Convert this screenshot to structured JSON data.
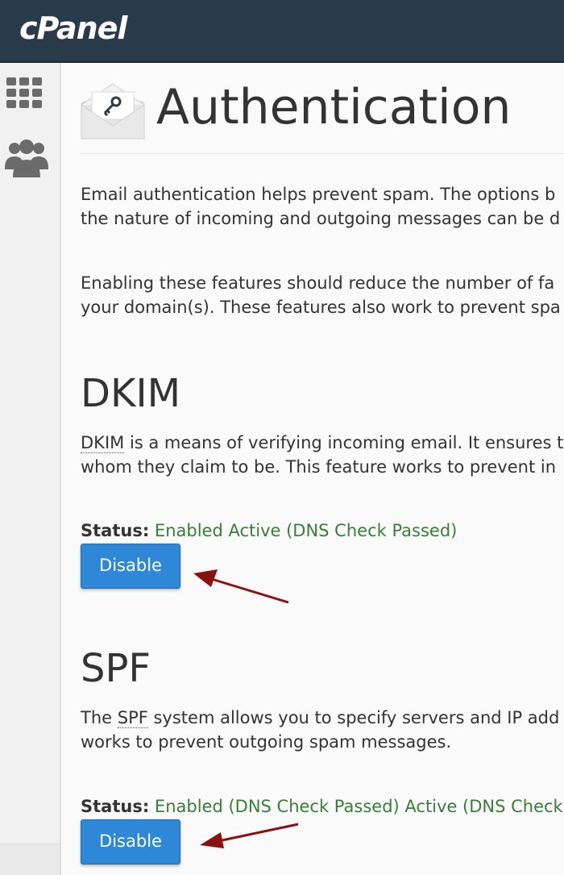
{
  "header": {
    "logo_text": "cPanel"
  },
  "sidebar": {
    "items": [
      {
        "icon": "grid-icon"
      },
      {
        "icon": "users-icon"
      }
    ]
  },
  "page": {
    "title": "Authentication",
    "intro_line1": "Email authentication helps prevent spam. The options b",
    "intro_line2": "the nature of incoming and outgoing messages can be d",
    "intro2_line1": "Enabling these features should reduce the number of fa",
    "intro2_line2": "your domain(s). These features also work to prevent spa"
  },
  "dkim": {
    "title": "DKIM",
    "abbr": "DKIM",
    "desc_line1_rest": " is a means of verifying incoming email. It ensures t",
    "desc_line2": "whom they claim to be. This feature works to prevent in",
    "status_label": "Status:",
    "status_value": "Enabled Active (DNS Check Passed)",
    "button_label": "Disable"
  },
  "spf": {
    "title": "SPF",
    "desc_line1_pre": "The ",
    "abbr": "SPF",
    "desc_line1_rest": " system allows you to specify servers and IP add",
    "desc_line2": "works to prevent outgoing spam messages.",
    "status_label": "Status:",
    "status_value": "Enabled (DNS Check Passed) Active (DNS Check",
    "button_label": "Disable"
  },
  "colors": {
    "topbar": "#293a4a",
    "button": "#2f87d8",
    "status_green": "#3a7d3a",
    "annotation_arrow": "#8b1010"
  }
}
